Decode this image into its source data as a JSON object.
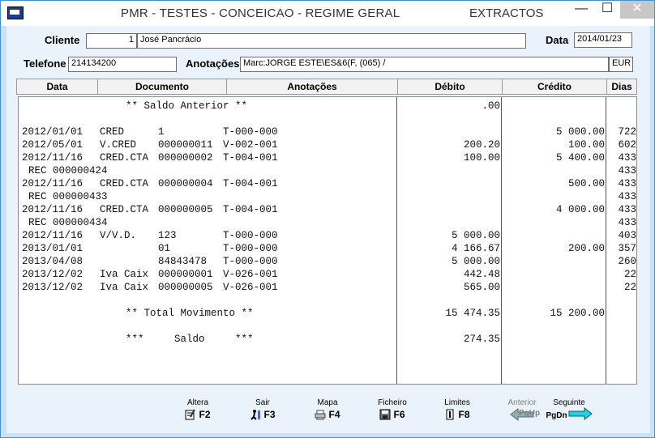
{
  "window": {
    "title": "PMR - TESTES - CONCEICAO - REGIME GERAL",
    "subtitle": "EXTRACTOS",
    "minimize": "—",
    "maximize": "☐",
    "close": "✕"
  },
  "form": {
    "cliente_label": "Cliente",
    "cliente_num": "1",
    "cliente_nome": "José Pancrácio",
    "data_label": "Data",
    "data_value": "2014/01/23",
    "telefone_label": "Telefone",
    "telefone_value": "214134200",
    "anotacoes_label": "Anotações",
    "anotacoes_value": "Marc:JORGE ESTE\\ES&6(F, (065)         /",
    "currency": "EUR"
  },
  "columns": [
    "Data",
    "Documento",
    "Anotações",
    "Débito",
    "Crédito",
    "Dias"
  ],
  "report": {
    "saldo_anterior": "** Saldo Anterior **",
    "saldo_anterior_val": ".00",
    "rows": [
      {
        "data": "2012/01/01",
        "tipo": "CRED",
        "doc": "1",
        "anot": "T-000-000",
        "debito": "",
        "credito": "5 000.00",
        "dias": "722"
      },
      {
        "data": "2012/05/01",
        "tipo": "V.CRED",
        "doc": "000000011",
        "anot": "V-002-001",
        "debito": "200.20",
        "credito": "100.00",
        "dias": "602"
      },
      {
        "data": "2012/11/16",
        "tipo": "CRED.CTA",
        "doc": "000000002",
        "anot": "T-004-001",
        "debito": "100.00",
        "credito": "5 400.00",
        "dias": "433"
      },
      {
        "data": "REC 000000424",
        "tipo": "",
        "doc": "",
        "anot": "",
        "debito": "",
        "credito": "",
        "dias": "433",
        "sub": true
      },
      {
        "data": "2012/11/16",
        "tipo": "CRED.CTA",
        "doc": "000000004",
        "anot": "T-004-001",
        "debito": "",
        "credito": "500.00",
        "dias": "433"
      },
      {
        "data": "REC 000000433",
        "tipo": "",
        "doc": "",
        "anot": "",
        "debito": "",
        "credito": "",
        "dias": "433",
        "sub": true
      },
      {
        "data": "2012/11/16",
        "tipo": "CRED.CTA",
        "doc": "000000005",
        "anot": "T-004-001",
        "debito": "",
        "credito": "4 000.00",
        "dias": "433"
      },
      {
        "data": "REC 000000434",
        "tipo": "",
        "doc": "",
        "anot": "",
        "debito": "",
        "credito": "",
        "dias": "433",
        "sub": true
      },
      {
        "data": "2012/11/16",
        "tipo": "V/V.D.",
        "doc": "123",
        "anot": "T-000-000",
        "debito": "5 000.00",
        "credito": "",
        "dias": "403"
      },
      {
        "data": "2013/01/01",
        "tipo": "",
        "doc": "01",
        "anot": "T-000-000",
        "debito": "4 166.67",
        "credito": "200.00",
        "dias": "357"
      },
      {
        "data": "2013/04/08",
        "tipo": "",
        "doc": "84843478",
        "anot": "T-000-000",
        "debito": "5 000.00",
        "credito": "",
        "dias": "260"
      },
      {
        "data": "2013/12/02",
        "tipo": "Iva Caix",
        "doc": "000000001",
        "anot": "V-026-001",
        "debito": "442.48",
        "credito": "",
        "dias": "22"
      },
      {
        "data": "2013/12/02",
        "tipo": "Iva Caix",
        "doc": "000000005",
        "anot": "V-026-001",
        "debito": "565.00",
        "credito": "",
        "dias": "22"
      }
    ],
    "total_label": "** Total Movimento **",
    "total_debito": "15 474.35",
    "total_credito": "15 200.00",
    "saldo_label": "***     Saldo     ***",
    "saldo_val": "274.35"
  },
  "toolbar": [
    {
      "label": "Altera",
      "key": "F2",
      "icon": "edit-icon",
      "disabled": false
    },
    {
      "label": "Sair",
      "key": "F3",
      "icon": "exit-icon",
      "disabled": false
    },
    {
      "label": "Mapa",
      "key": "F4",
      "icon": "printer-icon",
      "disabled": false
    },
    {
      "label": "Ficheiro",
      "key": "F6",
      "icon": "save-icon",
      "disabled": false
    },
    {
      "label": "Limites",
      "key": "F8",
      "icon": "limits-icon",
      "disabled": false
    },
    {
      "label": "Anterior",
      "key": "PgUp",
      "icon": "arrow-left-icon",
      "disabled": true
    },
    {
      "label": "Seguinte",
      "key": "PgDn",
      "icon": "arrow-right-icon",
      "disabled": false
    }
  ]
}
